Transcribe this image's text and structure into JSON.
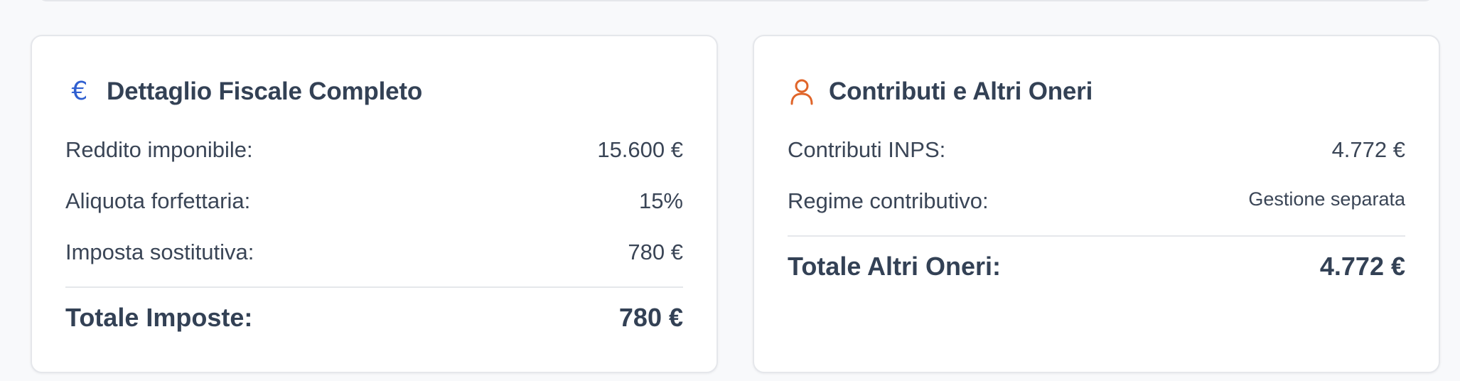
{
  "fiscal": {
    "title": "Dettaglio Fiscale Completo",
    "icon": "euro-icon",
    "rows": [
      {
        "label": "Reddito imponibile:",
        "value": "15.600 €"
      },
      {
        "label": "Aliquota forfettaria:",
        "value": "15%"
      },
      {
        "label": "Imposta sostitutiva:",
        "value": "780 €"
      }
    ],
    "total": {
      "label": "Totale Imposte:",
      "value": "780 €"
    }
  },
  "contrib": {
    "title": "Contributi e Altri Oneri",
    "icon": "user-icon",
    "rows": [
      {
        "label": "Contributi INPS:",
        "value": "4.772 €"
      },
      {
        "label": "Regime contributivo:",
        "value": "Gestione separata"
      }
    ],
    "total": {
      "label": "Totale Altri Oneri:",
      "value": "4.772 €"
    }
  },
  "colors": {
    "fiscal_accent": "#2f5fd0",
    "contrib_accent": "#e0652a",
    "text": "#334155",
    "border": "#e5e7eb",
    "background": "#f8f9fb"
  }
}
